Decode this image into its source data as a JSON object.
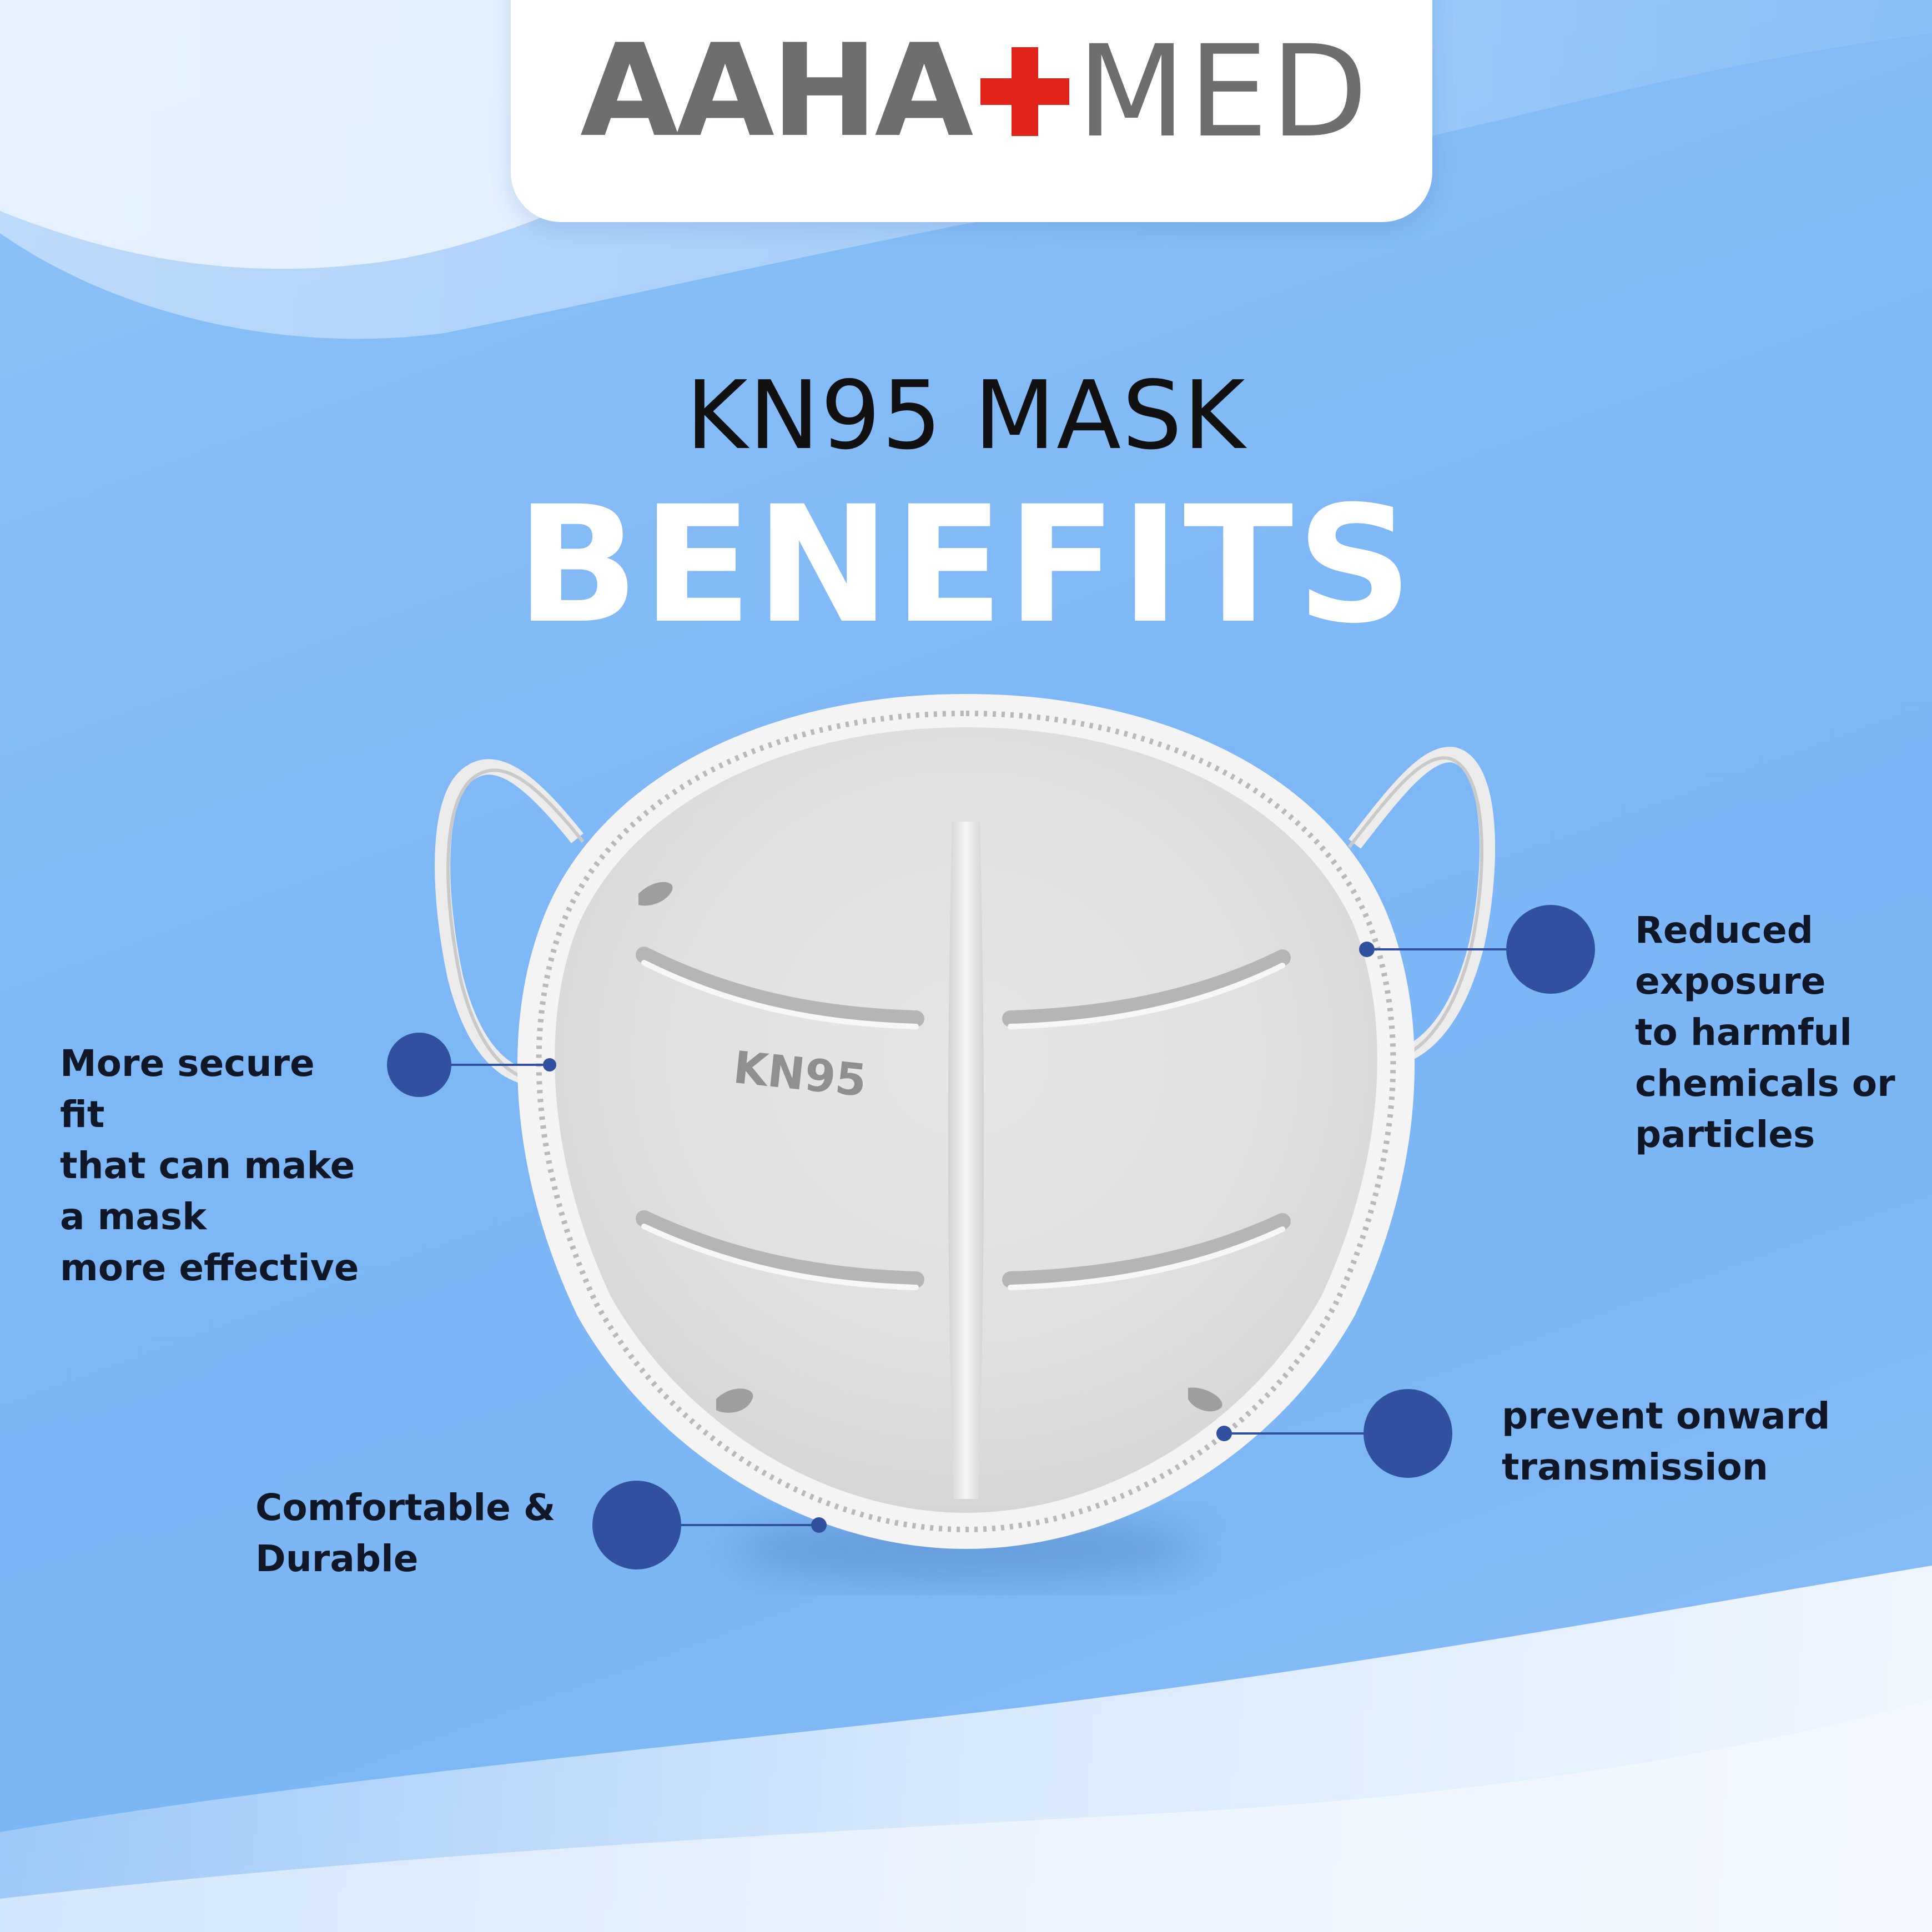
{
  "brand": {
    "name_left": "AAHA",
    "name_right": "MED",
    "cross_icon": "medical-cross-icon",
    "colors": {
      "text": "#6d6e70",
      "cross": "#e2231a",
      "card": "#ffffff"
    }
  },
  "headline": {
    "line1": "KN95 MASK",
    "line2": "BENEFITS"
  },
  "mask": {
    "imprint": "KN95",
    "icon": "kn95-mask-icon"
  },
  "benefits": [
    {
      "text": "More secure fit\nthat can make\na mask\nmore effective"
    },
    {
      "text": "Comfortable &\nDurable"
    },
    {
      "text": "Reduced\nexposure\nto harmful\nchemicals or\nparticles"
    },
    {
      "text": "prevent onward\ntransmission"
    }
  ],
  "colors": {
    "background": "#7db7f6",
    "callout_dot": "#3250a0",
    "heading_dark": "#111111",
    "heading_light": "#ffffff"
  }
}
